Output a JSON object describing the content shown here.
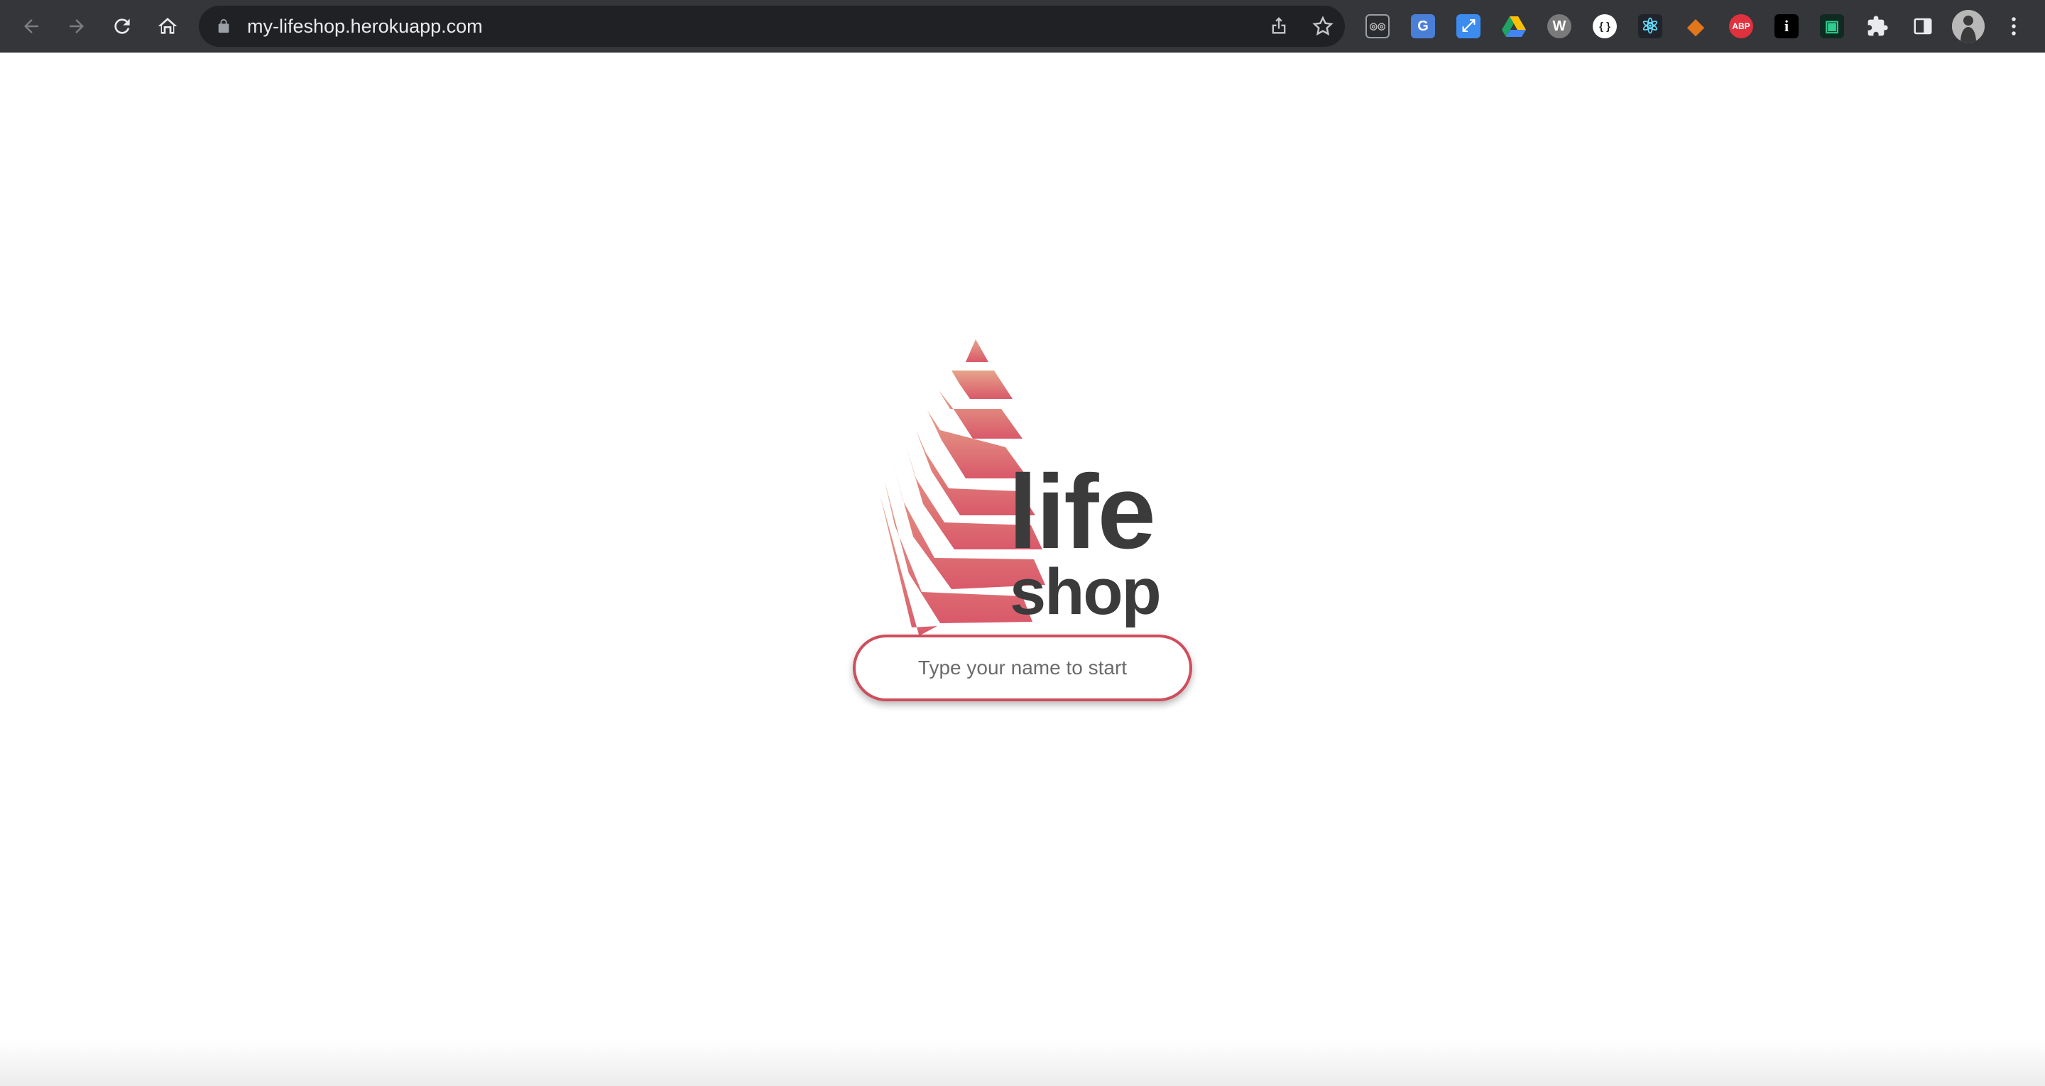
{
  "browser": {
    "url": "my-lifeshop.herokuapp.com",
    "extensions": [
      {
        "name": "glasses-extension-icon",
        "glyph": "◎◎",
        "color": "#5f6368"
      },
      {
        "name": "google-translate-icon",
        "glyph": "G",
        "color": "#4a7fd8"
      },
      {
        "name": "resize-extension-icon",
        "glyph": "⤢",
        "color": "#3c8cf0"
      },
      {
        "name": "google-drive-icon",
        "glyph": "▲",
        "color": "#1fa463"
      },
      {
        "name": "wappalyzer-icon",
        "glyph": "W",
        "color": "#7a7a7a"
      },
      {
        "name": "json-viewer-icon",
        "glyph": "{ }",
        "color": "#ffffff"
      },
      {
        "name": "react-devtools-icon",
        "glyph": "⚛",
        "color": "#61dafb"
      },
      {
        "name": "metamask-icon",
        "glyph": "◆",
        "color": "#e2761b"
      },
      {
        "name": "adblock-plus-icon",
        "glyph": "ABP",
        "color": "#e0313e"
      },
      {
        "name": "info-extension-icon",
        "glyph": "i",
        "color": "#000000"
      },
      {
        "name": "screen-extension-icon",
        "glyph": "▣",
        "color": "#123a2c"
      }
    ]
  },
  "app": {
    "logo_text": {
      "line1": "life",
      "line2": "shop"
    },
    "logo_colors": {
      "stripe_light": "#e6a48a",
      "stripe_dark": "#d9596a",
      "text": "#3b3b3b"
    },
    "name_input": {
      "placeholder": "Type your name to start",
      "value": "",
      "border_color": "#cf4d5c"
    }
  }
}
